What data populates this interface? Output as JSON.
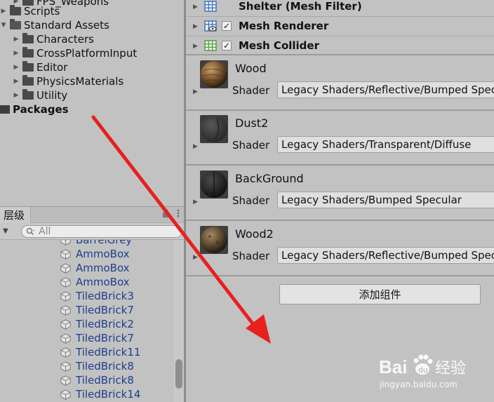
{
  "project": {
    "items": [
      {
        "label": "FPS_Weapons",
        "level": 1,
        "type": "folder"
      },
      {
        "label": "Scripts",
        "level": 0,
        "type": "folder"
      },
      {
        "label": "Standard Assets",
        "level": 0,
        "type": "folder-open"
      },
      {
        "label": "Characters",
        "level": 1,
        "type": "folder"
      },
      {
        "label": "CrossPlatformInput",
        "level": 1,
        "type": "folder"
      },
      {
        "label": "Editor",
        "level": 1,
        "type": "folder"
      },
      {
        "label": "PhysicsMaterials",
        "level": 1,
        "type": "folder"
      },
      {
        "label": "Utility",
        "level": 1,
        "type": "folder"
      },
      {
        "label": "Packages",
        "level": -1,
        "type": "package"
      }
    ]
  },
  "hierarchy": {
    "tab_label": "层级",
    "search_placeholder": "All",
    "items": [
      "BarrelGrey",
      "AmmoBox",
      "AmmoBox",
      "AmmoBox",
      "TiledBrick3",
      "TiledBrick7",
      "TiledBrick2",
      "TiledBrick7",
      "TiledBrick11",
      "TiledBrick8",
      "TiledBrick8",
      "TiledBrick14"
    ],
    "item_color": "#1c3f8c"
  },
  "inspector": {
    "components": [
      {
        "name": "Shelter (Mesh Filter)",
        "icon": "mesh-filter-icon",
        "checkbox": false
      },
      {
        "name": "Mesh Renderer",
        "icon": "mesh-renderer-icon",
        "checkbox": true
      },
      {
        "name": "Mesh Collider",
        "icon": "mesh-collider-icon",
        "checkbox": true
      }
    ],
    "materials": [
      {
        "name": "Wood",
        "shader_label": "Shader",
        "shader": "Legacy Shaders/Reflective/Bumped Specular",
        "preview": "wood"
      },
      {
        "name": "Dust2",
        "shader_label": "Shader",
        "shader": "Legacy Shaders/Transparent/Diffuse",
        "preview": "dark"
      },
      {
        "name": "BackGround",
        "shader_label": "Shader",
        "shader": "Legacy Shaders/Bumped Specular",
        "preview": "black"
      },
      {
        "name": "Wood2",
        "shader_label": "Shader",
        "shader": "Legacy Shaders/Reflective/Bumped Specular",
        "preview": "wood2"
      }
    ],
    "add_component_label": "添加组件"
  },
  "watermark": {
    "brand": "Baidu经验",
    "url": "jingyan.baidu.com"
  },
  "annotation": {
    "color": "#e8201e",
    "type": "red-arrow"
  }
}
